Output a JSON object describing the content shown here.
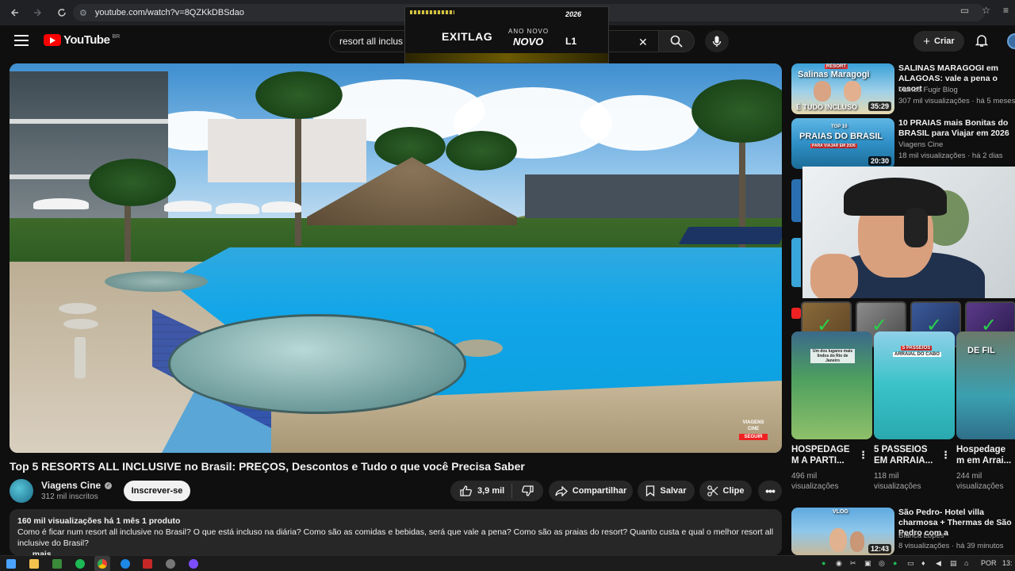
{
  "browser": {
    "url": "youtube.com/watch?v=8QZKkDBSdao",
    "icons": [
      "back-arrow-icon",
      "forward-arrow-icon",
      "reload-icon",
      "site-info-icon",
      "cast-icon",
      "bookmark-star-icon",
      "extensions-icon"
    ]
  },
  "header": {
    "logo_text": "YouTube",
    "country": "BR",
    "search_value": "resort all inclus",
    "create_label": "Criar"
  },
  "ad": {
    "year": "2026",
    "brand": "EXITLAG",
    "line1": "ANO NOVO",
    "line2": "NOVO",
    "symbol": "L1"
  },
  "video": {
    "title": "Top 5 RESORTS ALL INCLUSIVE no Brasil: PREÇOS, Descontos e Tudo o que você Precisa Saber",
    "watermark_line1": "VIAGENS",
    "watermark_line2": "CINE",
    "watermark_line3": "SEGUIR"
  },
  "channel": {
    "name": "Viagens Cine",
    "subs": "312 mil inscritos",
    "subscribe_label": "Inscrever-se"
  },
  "actions": {
    "likes": "3,9 mil",
    "share": "Compartilhar",
    "save": "Salvar",
    "clip": "Clipe"
  },
  "description": {
    "meta": "160 mil visualizações  há 1 mês  1 produto",
    "text": "Como é ficar num resort all inclusive no Brasil? O que está incluso na diária? Como são as comidas e bebidas, será que vale a pena? Como são as praias do resort? Quanto custa e qual o melhor resort all inclusive do Brasil?",
    "more": "...mais"
  },
  "recommendations": [
    {
      "title": "SALINAS MARAGOGI em ALAGOAS: vale a pena o resort",
      "channel": "Vamos Fugir Blog",
      "stats": "307 mil visualizações · há 5 meses",
      "duration": "35:29",
      "thumb_text1": "Salinas Maragogi",
      "thumb_text2": "É TUDO INCLUSO",
      "thumb_text3": "RESORT"
    },
    {
      "title": "10 PRAIAS mais Bonitas do BRASIL para Viajar em 2026",
      "channel": "Viagens Cine",
      "stats": "18 mil visualizações · há 2 dias",
      "duration": "20:30",
      "thumb_text1": "TOP 10",
      "thumb_text2": "PRAIAS DO BRASIL",
      "thumb_text3": "PARA VIAJAR EM 2026"
    },
    {
      "title": "São Pedro- Hotel villa charmosa + Thermas de São Pedro com a",
      "channel": "Bianca Lopes",
      "stats": "8 visualizações · há 39 minutos",
      "duration": "12:43",
      "thumb_text1": "VLOG"
    }
  ],
  "shorts": [
    {
      "title": "HOSPEDAGE M A PARTI...",
      "views": "496 mil visualizações",
      "overlay": "Um dos lugares mais lindos do Rio de Janeiro"
    },
    {
      "title": "5 PASSEIOS EM ARRAIA...",
      "views": "118 mil visualizações",
      "overlay1": "5 PASSEIOS",
      "overlay2": "ARRAIAL DO CABO"
    },
    {
      "title": "Hospedage m em Arrai...",
      "views": "244 mil visualizações",
      "overlay": "DE FIL"
    }
  ],
  "taskbar": {
    "lang": "POR",
    "time": "13:"
  },
  "colors": {
    "youtube_red": "#ff0000",
    "background": "#0f0f0f",
    "pill": "#272727",
    "check_green": "#2ad24a"
  }
}
